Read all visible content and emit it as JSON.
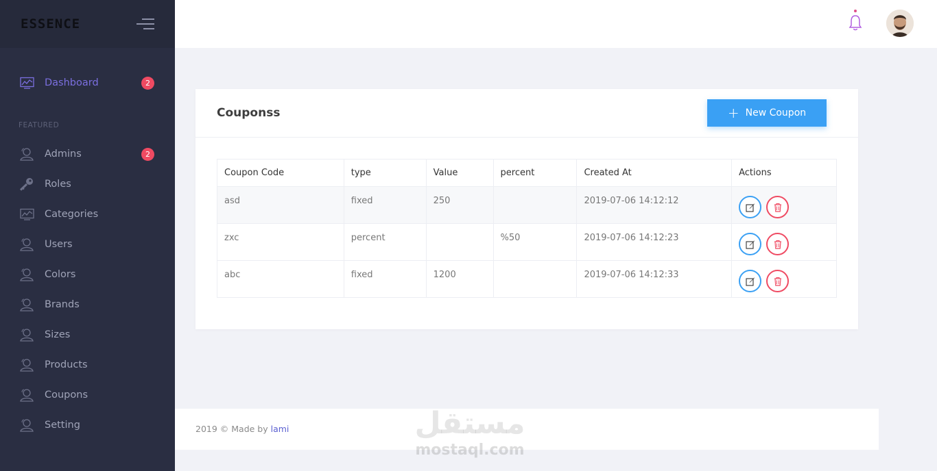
{
  "brand": {
    "name": "ESSENCE"
  },
  "sidebar": {
    "section_featured": "FEATURED",
    "items": [
      {
        "label": "Dashboard",
        "badge": "2",
        "icon": "chart-icon"
      },
      {
        "label": "Admins",
        "badge": "2",
        "icon": "users-icon"
      },
      {
        "label": "Roles",
        "icon": "key-icon"
      },
      {
        "label": "Categories",
        "icon": "chart-icon"
      },
      {
        "label": "Users",
        "icon": "users-icon"
      },
      {
        "label": "Colors",
        "icon": "users-icon"
      },
      {
        "label": "Brands",
        "icon": "users-icon"
      },
      {
        "label": "Sizes",
        "icon": "users-icon"
      },
      {
        "label": "Products",
        "icon": "users-icon"
      },
      {
        "label": "Coupons",
        "icon": "users-icon"
      },
      {
        "label": "Setting",
        "icon": "users-icon"
      }
    ]
  },
  "card": {
    "title": "Couponss",
    "new_button": "New Coupon",
    "columns": [
      "Coupon Code",
      "type",
      "Value",
      "percent",
      "Created At",
      "Actions"
    ],
    "rows": [
      {
        "code": "asd",
        "type": "fixed",
        "value": "250",
        "percent": "",
        "created": "2019-07-06 14:12:12"
      },
      {
        "code": "zxc",
        "type": "percent",
        "value": "",
        "percent": "%50",
        "created": "2019-07-06 14:12:23"
      },
      {
        "code": "abc",
        "type": "fixed",
        "value": "1200",
        "percent": "",
        "created": "2019-07-06 14:12:33"
      }
    ]
  },
  "footer": {
    "text": "2019 © Made by",
    "author": "lami"
  },
  "watermark": {
    "arabic": "مستقل",
    "latin": "mostaql.com"
  },
  "colors": {
    "accent": "#3aa0f4",
    "danger": "#ef4a62",
    "sidebar": "#2a2e42",
    "active": "#7b6fe0"
  }
}
